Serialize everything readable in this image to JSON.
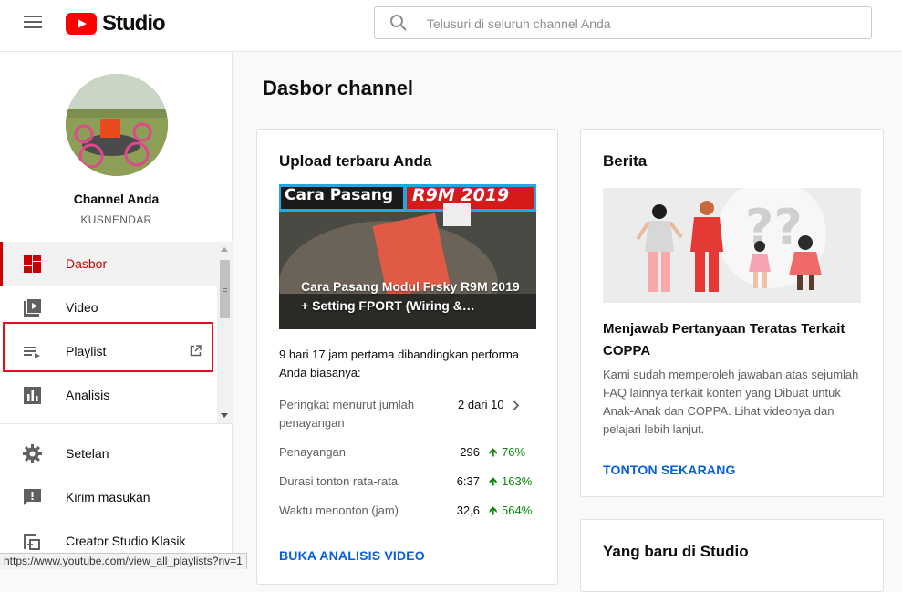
{
  "header": {
    "logo_text": "Studio",
    "search_placeholder": "Telusuri di seluruh channel Anda"
  },
  "sidebar": {
    "channel_name": "Channel Anda",
    "channel_sub": "KUSNENDAR",
    "items": [
      {
        "label": "Dasbor",
        "icon": "dashboard-icon",
        "active": true
      },
      {
        "label": "Video",
        "icon": "video-icon"
      },
      {
        "label": "Playlist",
        "icon": "playlist-icon"
      },
      {
        "label": "Analisis",
        "icon": "analytics-icon"
      }
    ],
    "bottom_items": [
      {
        "label": "Setelan",
        "icon": "gear-icon"
      },
      {
        "label": "Kirim masukan",
        "icon": "feedback-icon"
      },
      {
        "label": "Creator Studio Klasik",
        "icon": "classic-studio-icon"
      }
    ]
  },
  "statusbar": {
    "url": "https://www.youtube.com/view_all_playlists?nv=1"
  },
  "main": {
    "title": "Dasbor channel",
    "upload_card": {
      "title": "Upload terbaru Anda",
      "thumb_banner_1": "Cara Pasang",
      "thumb_banner_2": "R9M 2019",
      "video_title": "Cara Pasang Modul Frsky R9M 2019 + Setting FPORT (Wiring &…",
      "intro": "9 hari 17 jam pertama dibandingkan performa Anda biasanya:",
      "rank_label": "Peringkat menurut jumlah penayangan",
      "rank_value": "2 dari 10",
      "stats": [
        {
          "label": "Penayangan",
          "value": "296",
          "delta": "76%"
        },
        {
          "label": "Durasi tonton rata-rata",
          "value": "6:37",
          "delta": "163%"
        },
        {
          "label": "Waktu menonton (jam)",
          "value": "32,6",
          "delta": "564%"
        }
      ],
      "link": "BUKA ANALISIS VIDEO"
    },
    "news_card": {
      "title": "Berita",
      "headline": "Menjawab Pertanyaan Teratas Terkait COPPA",
      "body": "Kami sudah memperoleh jawaban atas sejumlah FAQ lainnya terkait konten yang Dibuat untuk Anak-Anak dan COPPA. Lihat videonya dan pelajari lebih lanjut.",
      "link": "TONTON SEKARANG"
    },
    "whats_new_card": {
      "title": "Yang baru di Studio"
    }
  },
  "colors": {
    "accent": "#cc0000",
    "link": "#065fd4",
    "positive": "#0a8a0a",
    "highlight": "#e0121b"
  }
}
